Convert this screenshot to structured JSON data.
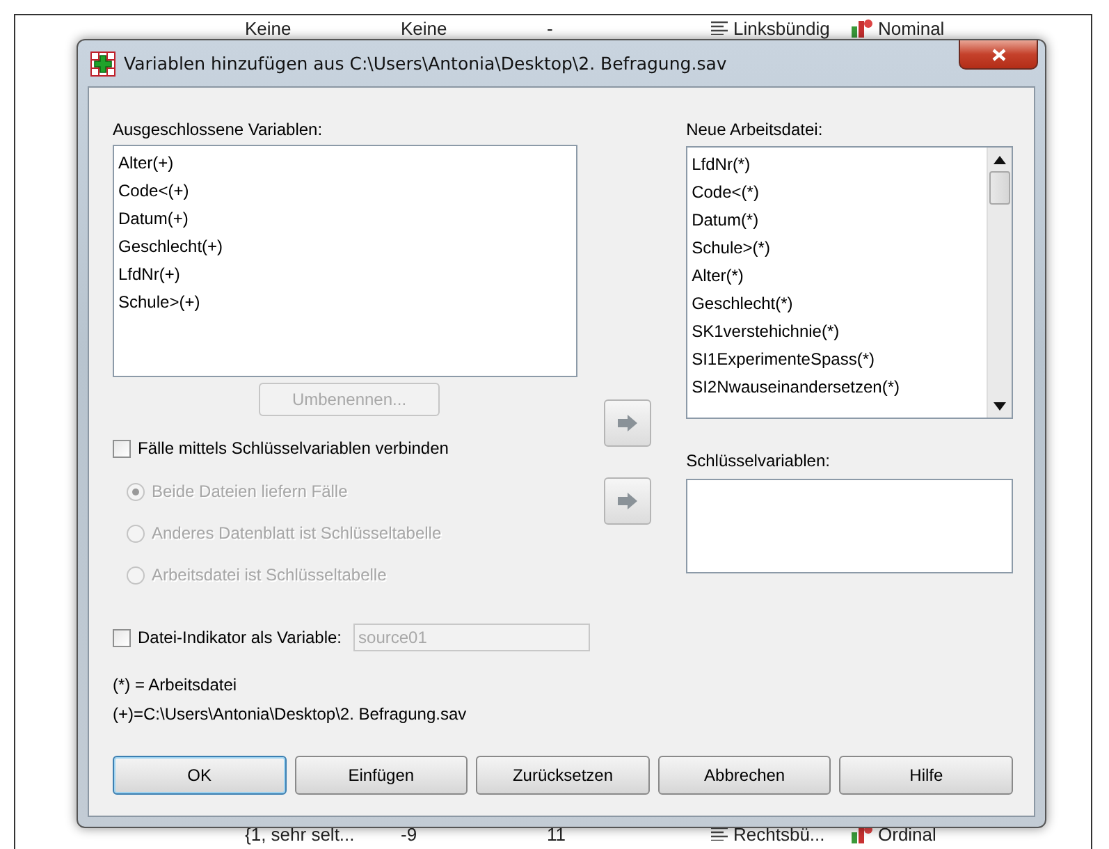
{
  "background": {
    "top_row": [
      "Keine",
      "Keine",
      "-",
      "Linksbündig",
      "Nominal"
    ],
    "bottom_row": [
      "{1, sehr selt...",
      "-9",
      "11",
      "Rechtsbü...",
      "Ordinal"
    ]
  },
  "dialog": {
    "title": "Variablen hinzufügen aus C:\\Users\\Antonia\\Desktop\\2. Befragung.sav"
  },
  "excluded": {
    "label": "Ausgeschlossene Variablen:",
    "items": [
      "Alter(+)",
      "Code<(+)",
      "Datum(+)",
      "Geschlecht(+)",
      "LfdNr(+)",
      "Schule>(+)"
    ]
  },
  "rename_button": {
    "label": "Umbenennen...",
    "disabled": true
  },
  "key_match": {
    "label": "Fälle mittels Schlüsselvariablen verbinden",
    "checked": false
  },
  "key_options": [
    {
      "label": "Beide Dateien liefern Fälle",
      "selected": true,
      "disabled": true
    },
    {
      "label": "Anderes Datenblatt ist Schlüsseltabelle",
      "selected": false,
      "disabled": true
    },
    {
      "label": "Arbeitsdatei ist Schlüsseltabelle",
      "selected": false,
      "disabled": true
    }
  ],
  "working_file": {
    "label": "Neue Arbeitsdatei:",
    "items": [
      "LfdNr(*)",
      "Code<(*)",
      "Datum(*)",
      "Schule>(*)",
      "Alter(*)",
      "Geschlecht(*)",
      "SK1verstehichnie(*)",
      "SI1ExperimenteSpass(*)",
      "SI2Nwauseinandersetzen(*)"
    ]
  },
  "key_variables": {
    "label": "Schlüsselvariablen:"
  },
  "file_indicator": {
    "label": "Datei-Indikator als Variable:",
    "checked": false,
    "value": "source01",
    "disabled": true
  },
  "notes": [
    "(*) = Arbeitsdatei",
    "(+)=C:\\Users\\Antonia\\Desktop\\2. Befragung.sav"
  ],
  "buttons": [
    {
      "label": "OK",
      "default": true
    },
    {
      "label": "Einfügen",
      "default": false
    },
    {
      "label": "Zurücksetzen",
      "default": false
    },
    {
      "label": "Abbrechen",
      "default": false
    },
    {
      "label": "Hilfe",
      "default": false
    }
  ]
}
